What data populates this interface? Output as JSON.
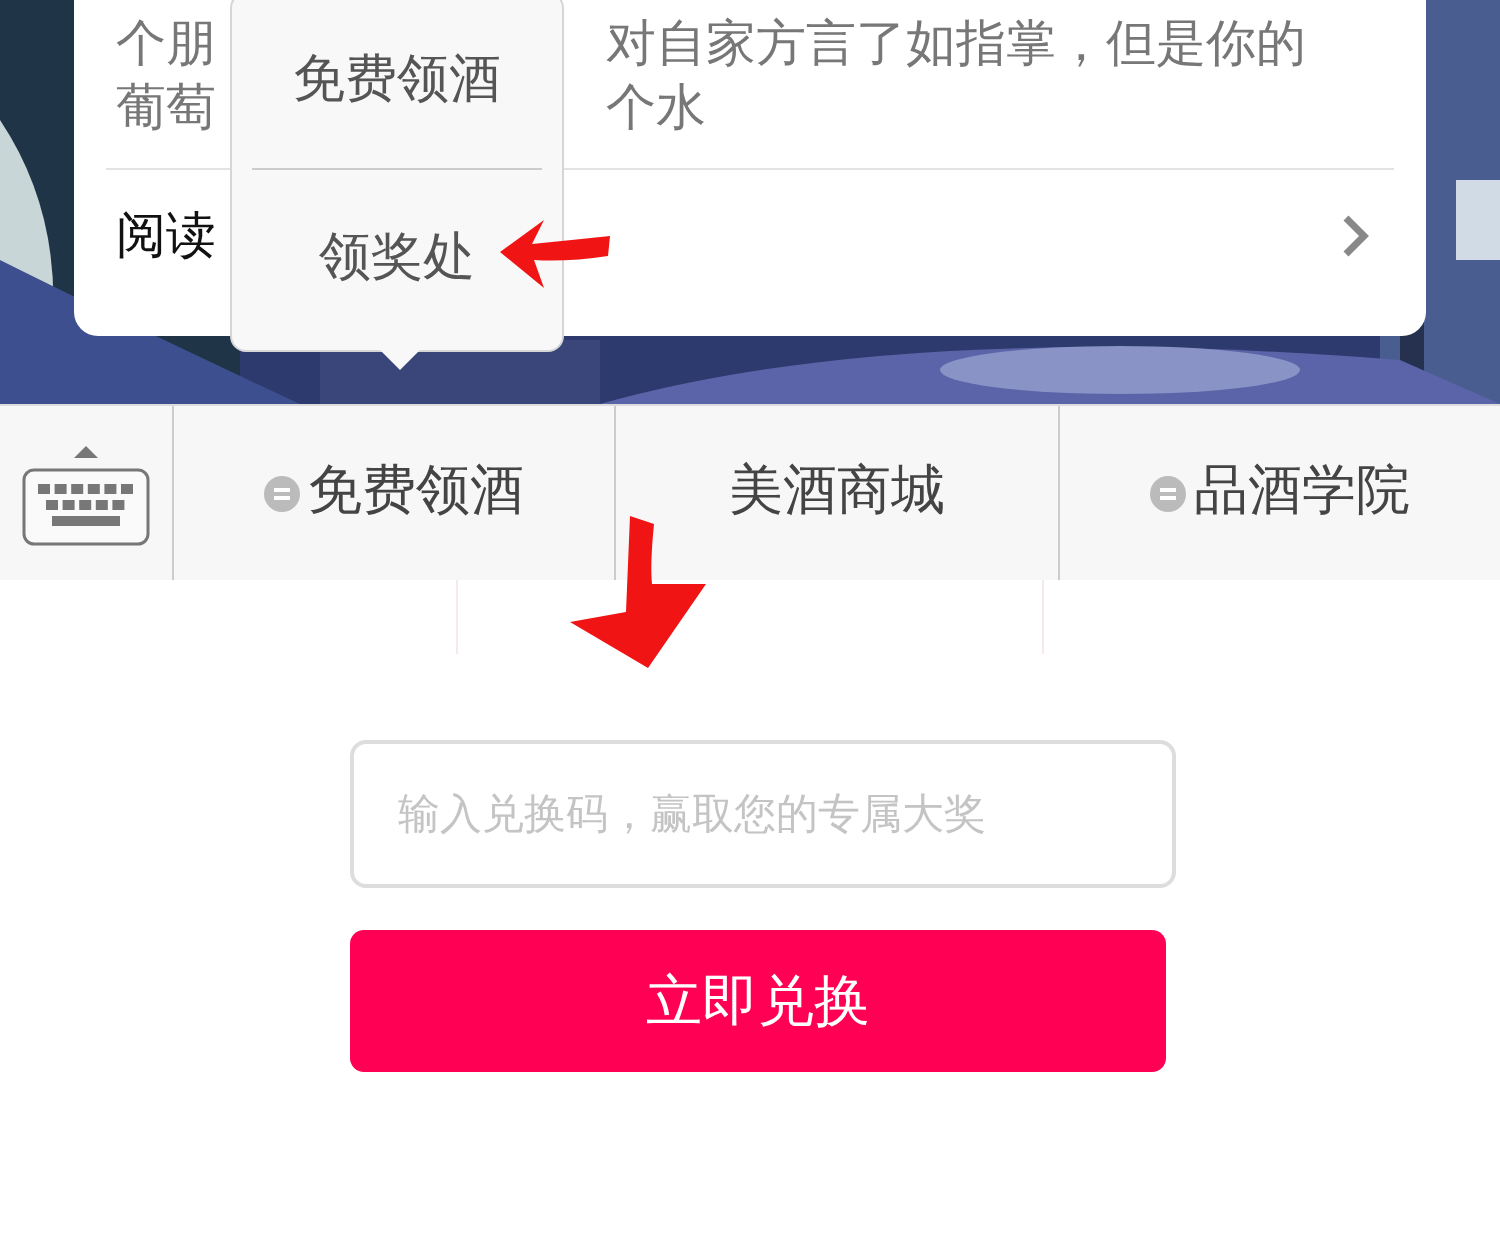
{
  "article": {
    "line_fragments": [
      {
        "left": "个朋",
        "right": "对自家方言了如指掌，但是你的"
      },
      {
        "left": "葡萄",
        "right": "个水"
      }
    ],
    "read_label": "阅读"
  },
  "popup": {
    "items": [
      {
        "label": "免费领酒"
      },
      {
        "label": "领奖处"
      }
    ]
  },
  "menu": {
    "items": [
      {
        "label": "免费领酒",
        "has_submenu": true
      },
      {
        "label": "美酒商城",
        "has_submenu": false
      },
      {
        "label": "品酒学院",
        "has_submenu": true
      }
    ]
  },
  "redeem": {
    "placeholder": "输入兑换码，赢取您的专属大奖",
    "button": "立即兑换"
  }
}
